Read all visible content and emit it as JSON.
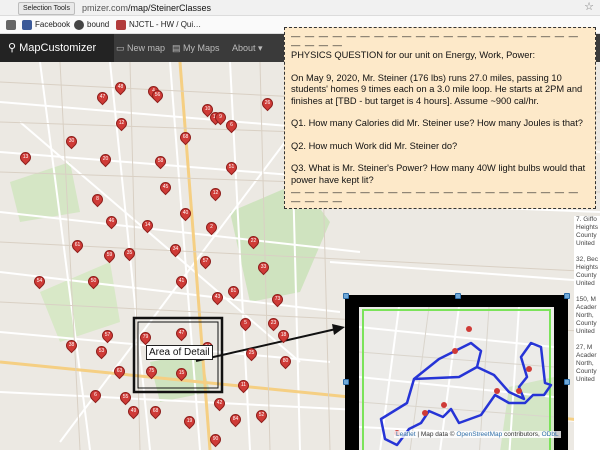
{
  "browser": {
    "tooltip": "Selection Tools",
    "url_prefix": "pmizer.com",
    "url_path": "/map/SteinerClasses"
  },
  "bookmarks": [
    {
      "label": "Facebook",
      "icon": "facebook-icon",
      "color": "#3b5998"
    },
    {
      "label": "bound",
      "icon": "globe-icon",
      "color": "#444444"
    },
    {
      "label": "NJCTL - HW / Qui…",
      "icon": "njctl-icon",
      "color": "#b23b3b"
    }
  ],
  "app": {
    "brand": "MapCustomizer",
    "new_map": "New map",
    "my_maps": "My Maps",
    "about": "About"
  },
  "question": {
    "rule_top": "— — — — — — — — — — — — — — — — — — — — — — — — —",
    "heading": "PHYSICS QUESTION for our unit on Energy, Work, Power:",
    "scenario": "On May 9, 2020, Mr. Steiner (176 lbs) runs 27.0 miles, passing 10 students' homes 9 times each on a 3.0 mile loop.  He starts at 2PM and finishes at [TBD - but target is 4 hours].  Assume ~900 cal/hr.",
    "q1": "Q1. How many Calories did Mr. Steiner use? How many Joules is that?",
    "q2": "Q2. How much Work did Mr. Steiner do?",
    "q3": "Q3. What is Mr. Steiner's Power?  How many 40W light bulbs would that power have kept lit?",
    "rule_bottom": "— — — — — — — — — — — — — — — — — — — — — — — — —"
  },
  "callout_label": "Area of Detail",
  "right_entries": [
    [
      "7. Giffo",
      "Heights",
      "County",
      "United"
    ],
    [
      "32, Bec",
      "Heights",
      "County",
      "United"
    ],
    [
      "150, M",
      "Acader",
      "North,",
      "County",
      "United"
    ],
    [
      "27, M",
      "Acader",
      "North,",
      "County",
      "United"
    ]
  ],
  "attribution": {
    "leaflet": "Leaflet",
    "sep": " | Map data © ",
    "osm": "OpenStreetMap",
    "suffix": " contributors, ",
    "odbl": "ODbL"
  },
  "pins": [
    "47",
    "48",
    "4",
    "56",
    "10",
    "26",
    "11",
    "12",
    "6",
    "9",
    "58",
    "51",
    "68",
    "12",
    "30",
    "13",
    "20",
    "45",
    "40",
    "8",
    "46",
    "14",
    "2",
    "59",
    "61",
    "35",
    "34",
    "57",
    "22",
    "33",
    "50",
    "54",
    "41",
    "43",
    "81",
    "73",
    "5",
    "23",
    "18",
    "38",
    "57",
    "79",
    "47",
    "74",
    "25",
    "80",
    "53",
    "63",
    "75",
    "15",
    "11",
    "6",
    "55",
    "42",
    "84",
    "52",
    "19",
    "49",
    "68",
    "90"
  ],
  "colors": {
    "route": "#2634d6",
    "inset_border": "#7be35a",
    "pin": "#cf3b37",
    "question_bg": "#fde9c9"
  }
}
